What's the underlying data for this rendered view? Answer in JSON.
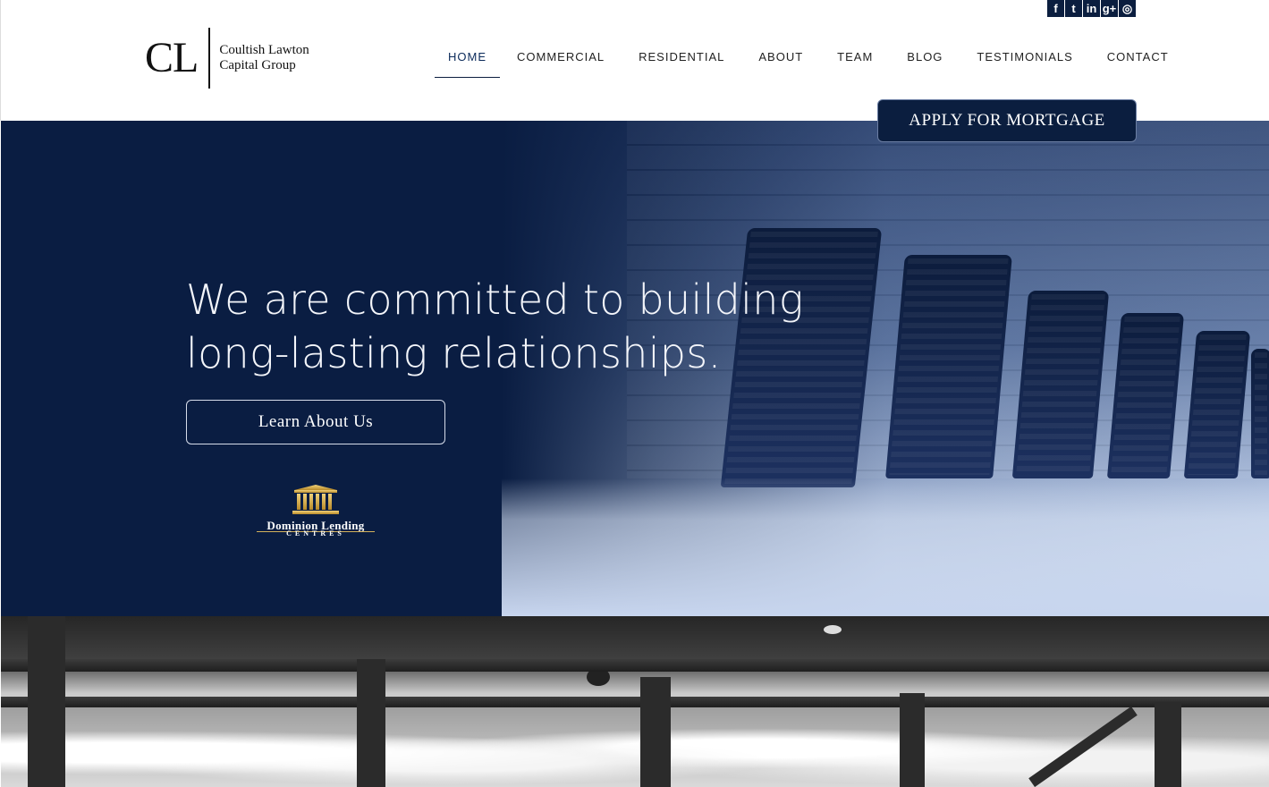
{
  "social": {
    "items": [
      {
        "icon": "facebook-icon",
        "glyph": "f"
      },
      {
        "icon": "twitter-icon",
        "glyph": "t"
      },
      {
        "icon": "linkedin-icon",
        "glyph": "in"
      },
      {
        "icon": "google-plus-icon",
        "glyph": "g+"
      },
      {
        "icon": "instagram-icon",
        "glyph": "◎"
      }
    ]
  },
  "logo": {
    "monogram": "CL",
    "line1": "Coultish Lawton",
    "line2": "Capital Group"
  },
  "nav": {
    "items": [
      "HOME",
      "COMMERCIAL",
      "RESIDENTIAL",
      "ABOUT",
      "TEAM",
      "BLOG",
      "TESTIMONIALS",
      "CONTACT"
    ],
    "active": "HOME"
  },
  "apply_button": "APPLY FOR MORTGAGE",
  "hero": {
    "headline_line1": "We are committed to building",
    "headline_line2": "long-lasting relationships.",
    "cta": "Learn About Us"
  },
  "partner_logo": {
    "line1": "Dominion Lending",
    "line2": "CENTRES"
  },
  "colors": {
    "navy": "#0a1d42",
    "accent_gold": "#d4b25b"
  }
}
